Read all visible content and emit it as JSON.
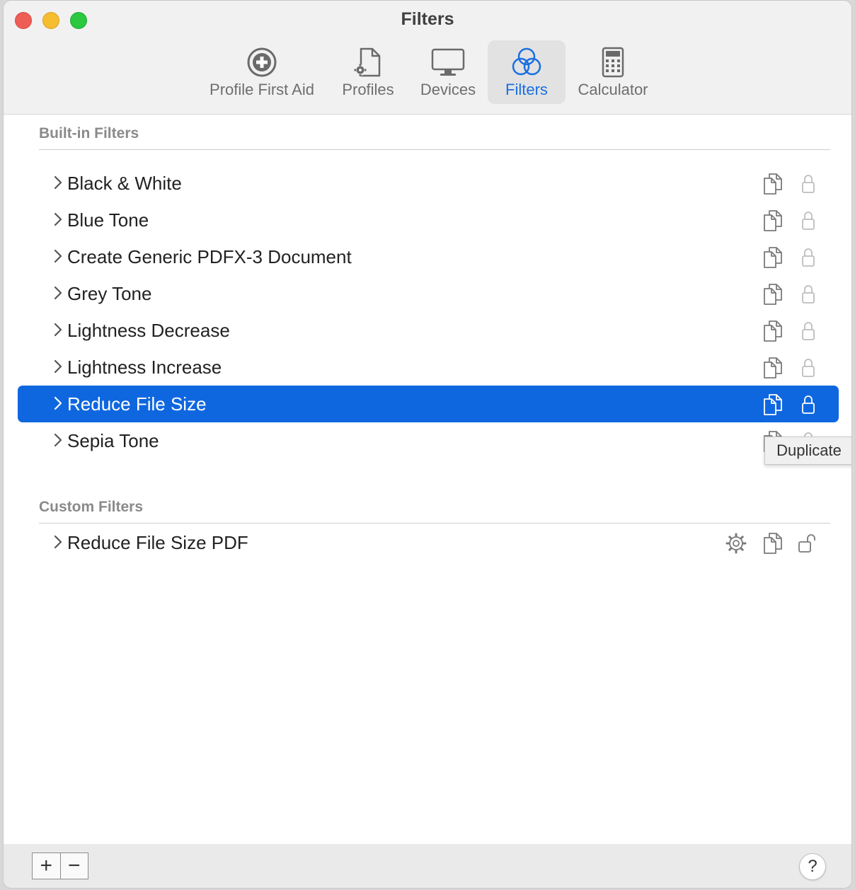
{
  "window": {
    "title": "Filters"
  },
  "toolbar": [
    {
      "label": "Profile First Aid",
      "icon": "plus-circle-icon",
      "active": false
    },
    {
      "label": "Profiles",
      "icon": "document-gear-icon",
      "active": false
    },
    {
      "label": "Devices",
      "icon": "monitor-icon",
      "active": false
    },
    {
      "label": "Filters",
      "icon": "three-circles-icon",
      "active": true
    },
    {
      "label": "Calculator",
      "icon": "calculator-icon",
      "active": false
    }
  ],
  "builtin": {
    "title": "Built-in Filters",
    "items": [
      {
        "label": "Black & White"
      },
      {
        "label": "Blue Tone"
      },
      {
        "label": "Create Generic PDFX-3 Document"
      },
      {
        "label": "Grey Tone"
      },
      {
        "label": "Lightness Decrease"
      },
      {
        "label": "Lightness Increase"
      },
      {
        "label": "Reduce File Size",
        "selected": true
      },
      {
        "label": "Sepia Tone"
      }
    ]
  },
  "tooltip": {
    "text": "Duplicate"
  },
  "custom": {
    "title": "Custom Filters",
    "items": [
      {
        "label": "Reduce File Size PDF"
      }
    ]
  },
  "bottom": {
    "add": "+",
    "remove": "−",
    "help": "?"
  },
  "colors": {
    "accent": "#0f67df",
    "selected_row": "#0f67df"
  }
}
